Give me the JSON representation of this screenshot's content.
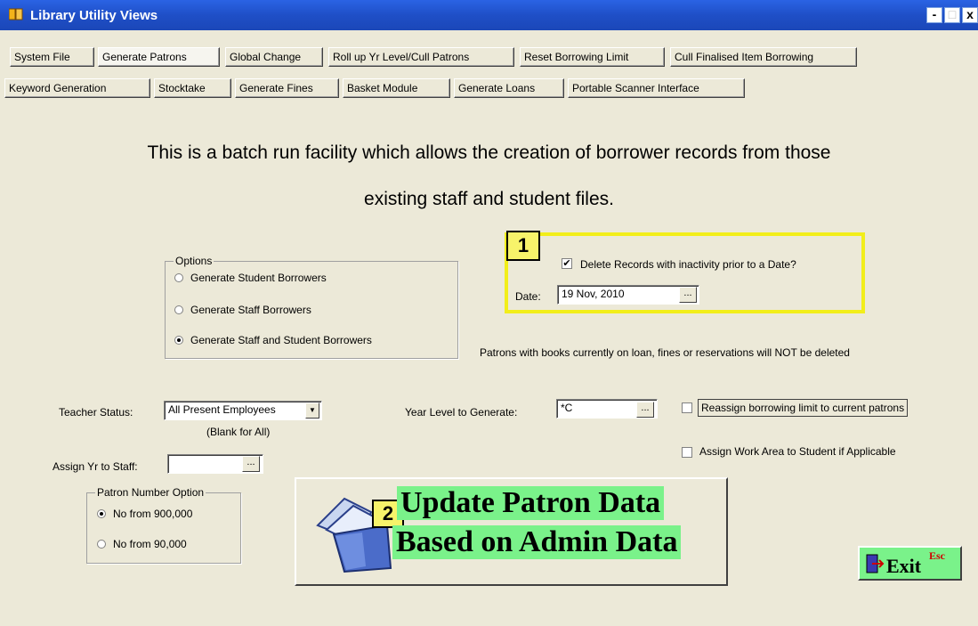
{
  "window": {
    "title": "Library Utility Views",
    "min_label": "-",
    "max_label": "□",
    "close_label": "x"
  },
  "tabs_row1": [
    {
      "label": "System File"
    },
    {
      "label": "Generate Patrons",
      "active": true
    },
    {
      "label": "Global Change"
    },
    {
      "label": "Roll up Yr Level/Cull Patrons"
    },
    {
      "label": "Reset Borrowing Limit"
    },
    {
      "label": "Cull Finalised Item Borrowing"
    }
  ],
  "tabs_row2": [
    {
      "label": "Keyword Generation"
    },
    {
      "label": "Stocktake"
    },
    {
      "label": "Generate Fines"
    },
    {
      "label": "Basket Module"
    },
    {
      "label": "Generate Loans"
    },
    {
      "label": "Portable Scanner Interface"
    }
  ],
  "intro": {
    "line1": "This is a batch run facility which allows the creation of borrower records from those",
    "line2": "existing staff and student files."
  },
  "options": {
    "title": "Options",
    "items": [
      {
        "label": "Generate Student Borrowers",
        "selected": false
      },
      {
        "label": "Generate Staff Borrowers",
        "selected": false
      },
      {
        "label": "Generate Staff and Student Borrowers",
        "selected": true
      }
    ]
  },
  "delete_section": {
    "badge": "1",
    "checkbox_label": "Delete Records with inactivity prior to a Date?",
    "checked": true,
    "date_label": "Date:",
    "date_value": "19 Nov, 2010",
    "ellipsis": "...",
    "note": "Patrons with books currently on loan, fines or reservations will NOT be deleted"
  },
  "teacher_status": {
    "label": "Teacher Status:",
    "value": "All Present Employees",
    "hint": "(Blank for All)"
  },
  "year_level": {
    "label": "Year Level to Generate:",
    "value": "*C",
    "ellipsis": "..."
  },
  "reassign": {
    "label": "Reassign borrowing limit to current patrons",
    "checked": false
  },
  "work_area": {
    "label": "Assign Work Area to Student if Applicable",
    "checked": false
  },
  "assign_yr": {
    "label": "Assign Yr to Staff:",
    "value": "",
    "ellipsis": "..."
  },
  "patron_number": {
    "title": "Patron Number Option",
    "items": [
      {
        "label": "No from 900,000",
        "selected": true
      },
      {
        "label": "No from 90,000",
        "selected": false
      }
    ]
  },
  "update_button": {
    "badge": "2",
    "line1": "Update Patron Data",
    "line2": "Based on Admin Data"
  },
  "exit_button": {
    "label": "Exit",
    "shortcut": "Esc"
  },
  "colors": {
    "titlebar": "#1f4fc7",
    "highlight_yellow": "#f2ee1a",
    "button_green": "#7af28a"
  }
}
